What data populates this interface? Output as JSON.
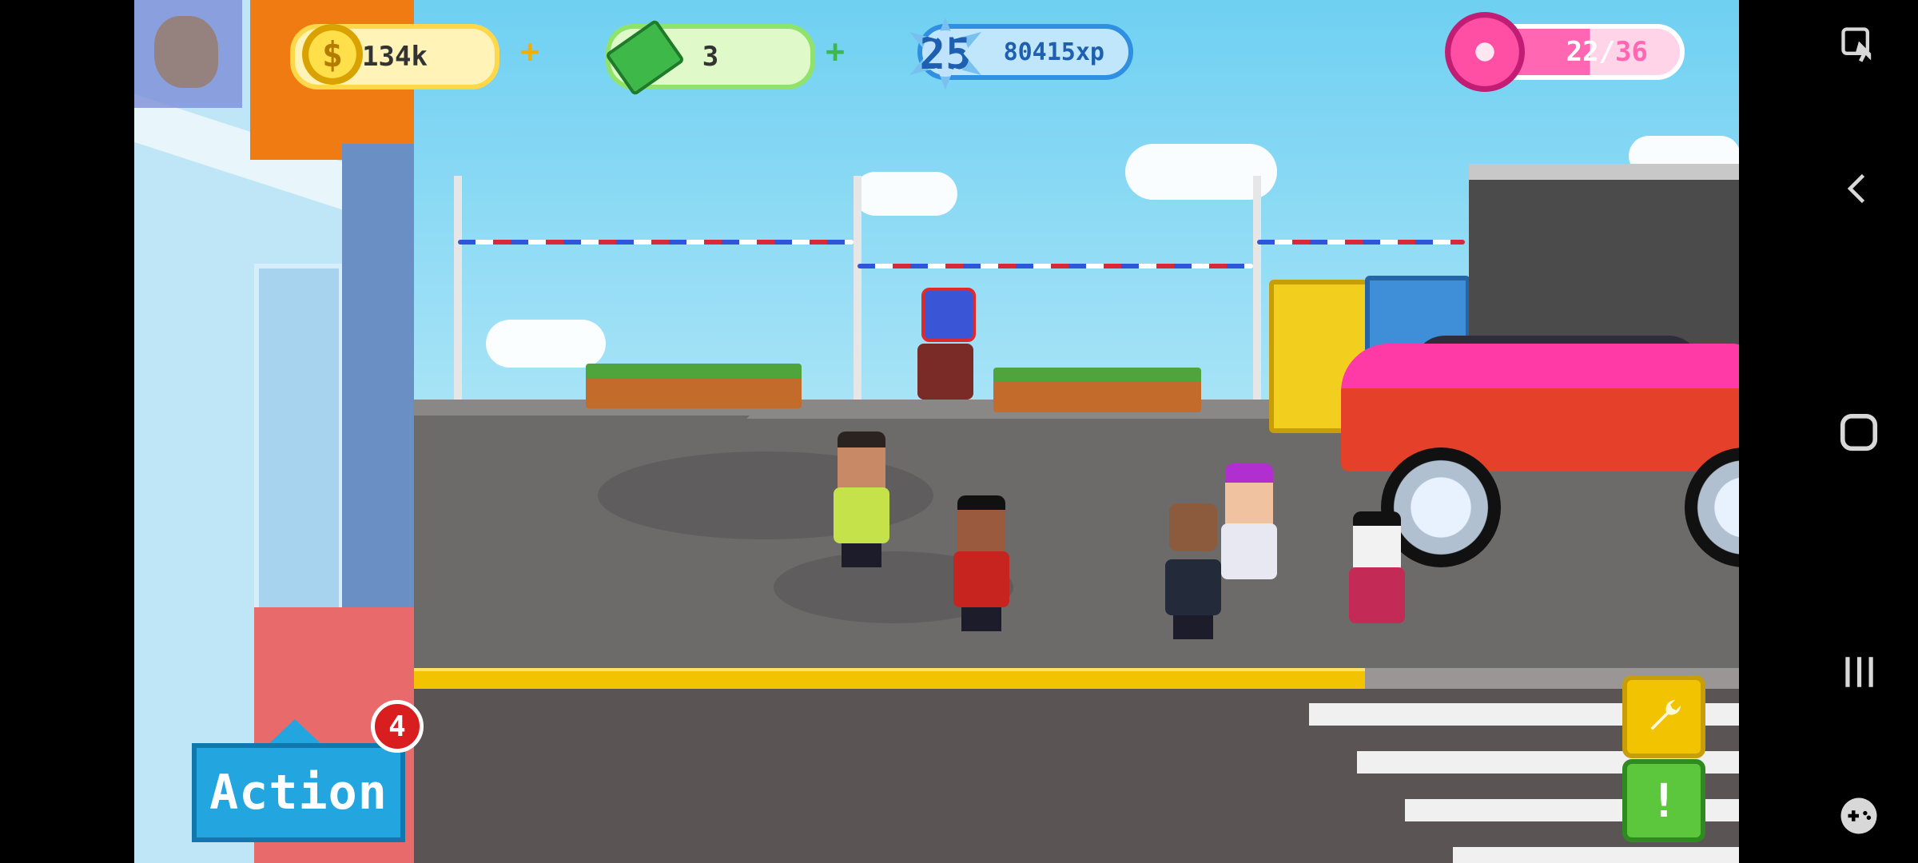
{
  "hud": {
    "coins": "134k",
    "coin_symbol": "$",
    "cash": "3",
    "level": "25",
    "xp": "80415xp",
    "donuts_current": "22/",
    "donuts_max": "36",
    "plus": "+"
  },
  "action_button": {
    "label": "Action",
    "badge_count": "4"
  },
  "side_buttons": {
    "alert_symbol": "!"
  },
  "system_nav": {
    "accessibility_icon": "accessibility-icon",
    "back_icon": "back-icon",
    "home_icon": "home-icon",
    "recents_icon": "recents-icon",
    "game_icon": "gamepad-icon"
  },
  "colors": {
    "coin_bar": "#ffd84a",
    "cash_bar": "#8fe36a",
    "xp_bar": "#2f8fe0",
    "donut_bar": "#ff67b3",
    "action": "#23a6e0"
  }
}
